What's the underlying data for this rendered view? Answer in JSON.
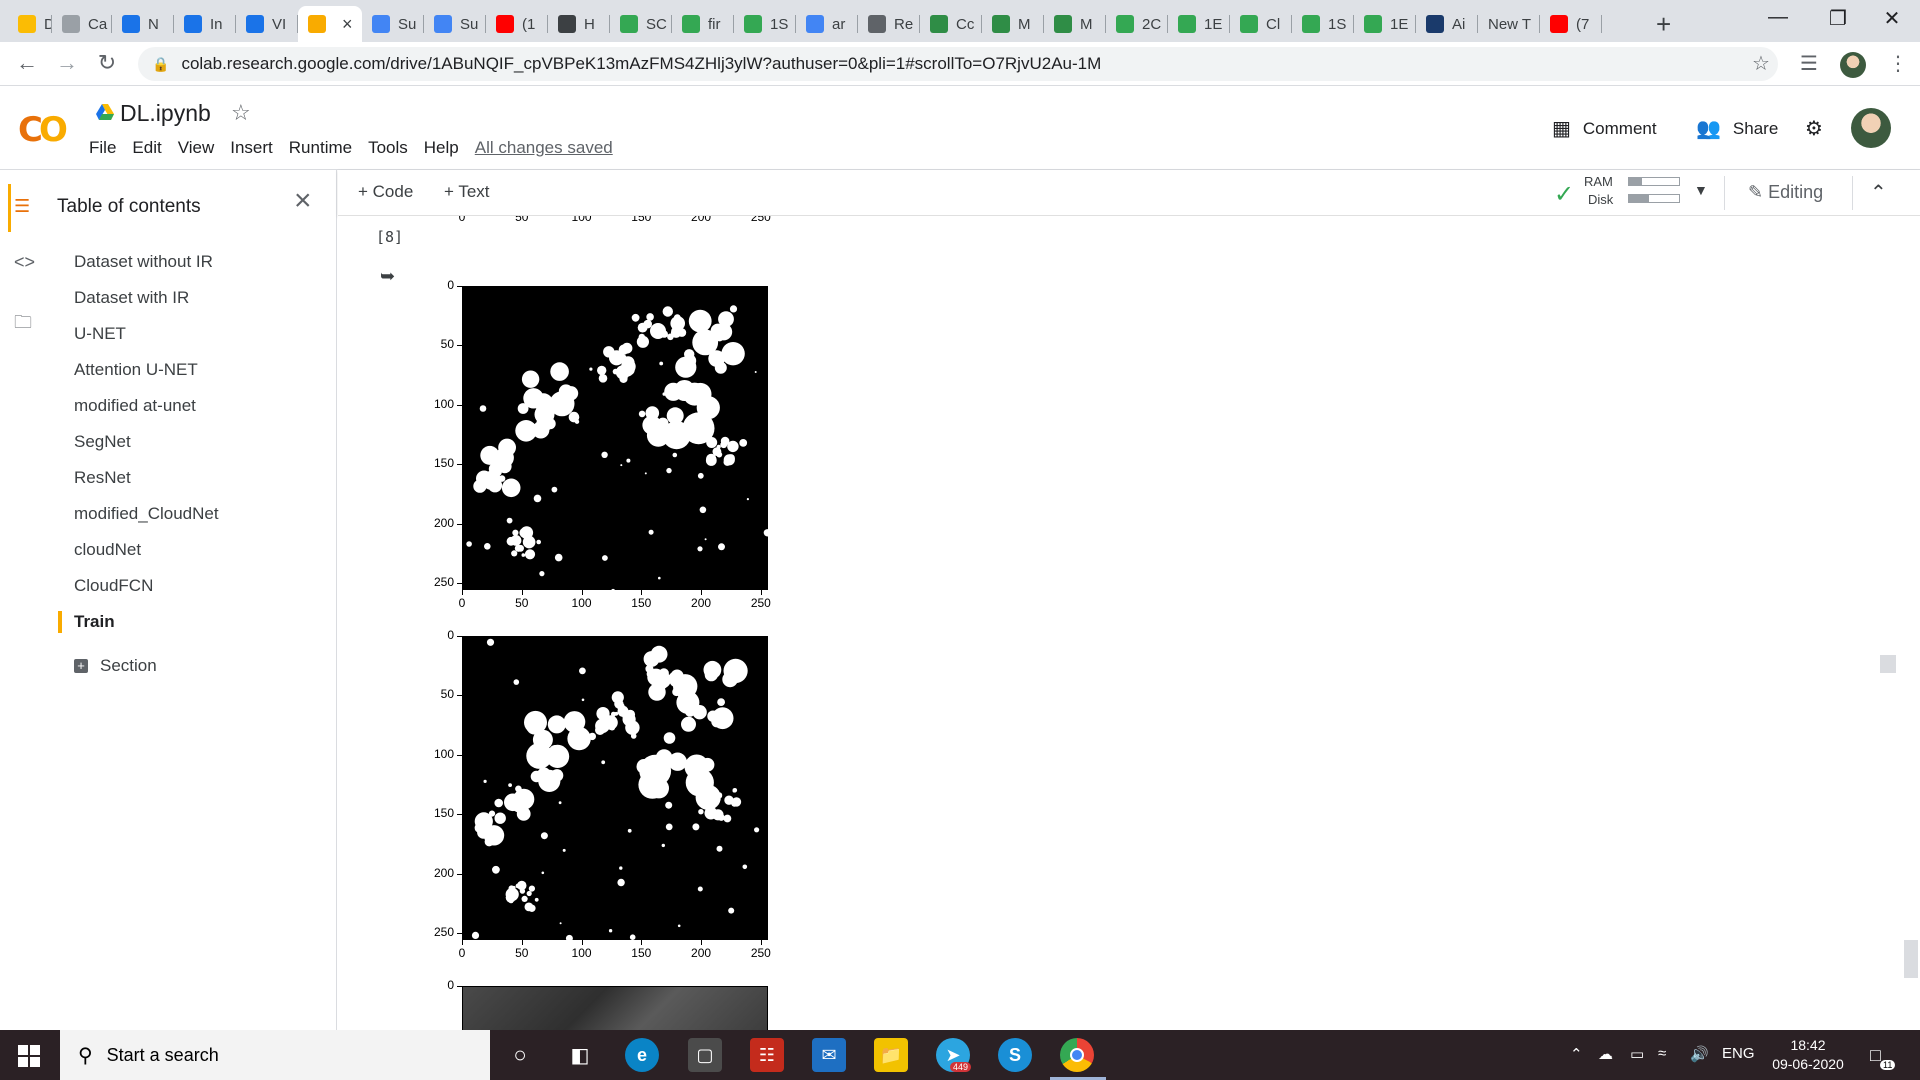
{
  "browser": {
    "tabs": [
      {
        "label": "De",
        "icon": "chrome-icon",
        "color": "#fbbc04"
      },
      {
        "label": "Ca",
        "icon": "ieee-icon",
        "color": "#9aa0a6"
      },
      {
        "label": "N",
        "icon": "colab-icon",
        "color": "#1a73e8"
      },
      {
        "label": "In",
        "icon": "colab-icon",
        "color": "#1a73e8"
      },
      {
        "label": "VI",
        "icon": "colab-icon",
        "color": "#1a73e8"
      },
      {
        "label": "",
        "icon": "colab-icon",
        "color": "#f9ab00",
        "active": true
      },
      {
        "label": "Su",
        "icon": "google-icon",
        "color": "#4285f4"
      },
      {
        "label": "Su",
        "icon": "google-icon",
        "color": "#4285f4"
      },
      {
        "label": "(1",
        "icon": "youtube-icon",
        "color": "#ff0000"
      },
      {
        "label": "H",
        "icon": "overleaf-icon",
        "color": "#3c4043"
      },
      {
        "label": "SC",
        "icon": "sheet-icon",
        "color": "#34a853"
      },
      {
        "label": "fir",
        "icon": "leaf-icon",
        "color": "#34a853"
      },
      {
        "label": "1S",
        "icon": "smiley-icon",
        "color": "#34a853"
      },
      {
        "label": "ar",
        "icon": "google-icon",
        "color": "#4285f4"
      },
      {
        "label": "Re",
        "icon": "globe-icon",
        "color": "#5f6368"
      },
      {
        "label": "Cc",
        "icon": "geeks-icon",
        "color": "#2f8d46"
      },
      {
        "label": "M",
        "icon": "geeks-icon",
        "color": "#2f8d46"
      },
      {
        "label": "M",
        "icon": "geeks-icon",
        "color": "#2f8d46"
      },
      {
        "label": "2C",
        "icon": "smiley-icon",
        "color": "#34a853"
      },
      {
        "label": "1E",
        "icon": "smiley-icon",
        "color": "#34a853"
      },
      {
        "label": "Cl",
        "icon": "leaf-icon",
        "color": "#34a853"
      },
      {
        "label": "1S",
        "icon": "smiley-icon",
        "color": "#34a853"
      },
      {
        "label": "1E",
        "icon": "smiley-icon",
        "color": "#34a853"
      },
      {
        "label": "Ai",
        "icon": "arxiv-icon",
        "color": "#1a3a6b"
      },
      {
        "label": "New T",
        "icon": "",
        "color": ""
      },
      {
        "label": "(7",
        "icon": "youtube-icon",
        "color": "#ff0000"
      }
    ],
    "url": "colab.research.google.com/drive/1ABuNQIF_cpVBPeK13mAzFMS4ZHlj3ylW?authuser=0&pli=1#scrollTo=O7RjvU2Au-1M"
  },
  "header": {
    "title": "DL.ipynb",
    "menu": [
      "File",
      "Edit",
      "View",
      "Insert",
      "Runtime",
      "Tools",
      "Help"
    ],
    "saved_status": "All changes saved",
    "comment_label": "Comment",
    "share_label": "Share"
  },
  "sidebar": {
    "title": "Table of contents",
    "items": [
      {
        "label": "Dataset without IR"
      },
      {
        "label": "Dataset with IR"
      },
      {
        "label": "U-NET"
      },
      {
        "label": "Attention U-NET"
      },
      {
        "label": "modified at-unet"
      },
      {
        "label": "SegNet"
      },
      {
        "label": "ResNet"
      },
      {
        "label": "modified_CloudNet"
      },
      {
        "label": "cloudNet"
      },
      {
        "label": "CloudFCN"
      },
      {
        "label": "Train",
        "active": true
      }
    ],
    "section_label": "Section"
  },
  "notebook_toolbar": {
    "code_label": "+ Code",
    "text_label": "+ Text",
    "ram_label": "RAM",
    "disk_label": "Disk",
    "ram_level": 0.25,
    "disk_level": 0.4,
    "editing_label": "Editing"
  },
  "cell": {
    "execution_count": "[8]"
  },
  "chart_data": [
    {
      "type": "image",
      "title": "",
      "x_ticks": [
        "0",
        "50",
        "100",
        "150",
        "200",
        "250"
      ],
      "y_ticks": [
        "250"
      ],
      "note": "partially visible grayscale image"
    },
    {
      "type": "image",
      "title": "",
      "x_ticks": [
        "0",
        "50",
        "100",
        "150",
        "200",
        "250"
      ],
      "y_ticks": [
        "0",
        "50",
        "100",
        "150",
        "200",
        "250"
      ],
      "note": "binary cloud mask"
    },
    {
      "type": "image",
      "title": "",
      "x_ticks": [
        "0",
        "50",
        "100",
        "150",
        "200",
        "250"
      ],
      "y_ticks": [
        "0",
        "50",
        "100",
        "150",
        "200",
        "250"
      ],
      "note": "binary cloud mask"
    },
    {
      "type": "image",
      "title": "",
      "x_ticks": [],
      "y_ticks": [
        "0"
      ],
      "note": "partially visible grayscale image"
    }
  ],
  "taskbar": {
    "search_placeholder": "Start a search",
    "telegram_badge": "449",
    "language": "ENG",
    "time": "18:42",
    "date": "09-06-2020",
    "notification_count": "11"
  }
}
